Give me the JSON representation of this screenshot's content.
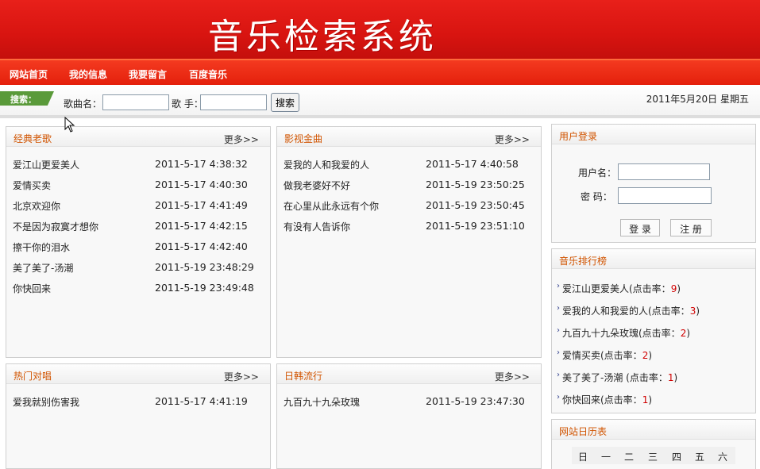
{
  "banner": {
    "title": "音乐检索系统"
  },
  "nav": {
    "items": [
      "网站首页",
      "我的信息",
      "我要留言",
      "百度音乐"
    ]
  },
  "search": {
    "tag": "搜索：",
    "song_label": "歌曲名：",
    "singer_label": "歌 手：",
    "button": "搜索",
    "song_value": "",
    "singer_value": ""
  },
  "date": "2011年5月20日 星期五",
  "panels": [
    {
      "title": "经典老歌",
      "more": "更多>>",
      "items": [
        {
          "song": "爱江山更爱美人",
          "time": "2011-5-17 4:38:32"
        },
        {
          "song": "爱情买卖",
          "time": "2011-5-17 4:40:30"
        },
        {
          "song": "北京欢迎你",
          "time": "2011-5-17 4:41:49"
        },
        {
          "song": "不是因为寂寞才想你",
          "time": "2011-5-17 4:42:15"
        },
        {
          "song": "擦干你的泪水",
          "time": "2011-5-17 4:42:40"
        },
        {
          "song": "美了美了-汤潮",
          "time": "2011-5-19 23:48:29"
        },
        {
          "song": "你快回来",
          "time": "2011-5-19 23:49:48"
        }
      ]
    },
    {
      "title": "影视金曲",
      "more": "更多>>",
      "items": [
        {
          "song": "爱我的人和我爱的人",
          "time": "2011-5-17 4:40:58"
        },
        {
          "song": "做我老婆好不好",
          "time": "2011-5-19 23:50:25"
        },
        {
          "song": "在心里从此永远有个你",
          "time": "2011-5-19 23:50:45"
        },
        {
          "song": "有没有人告诉你",
          "time": "2011-5-19 23:51:10"
        }
      ]
    },
    {
      "title": "热门对唱",
      "more": "更多>>",
      "items": [
        {
          "song": "爱我就别伤害我",
          "time": "2011-5-17 4:41:19"
        }
      ]
    },
    {
      "title": "日韩流行",
      "more": "更多>>",
      "items": [
        {
          "song": "九百九十九朵玫瑰",
          "time": "2011-5-19 23:47:30"
        }
      ]
    }
  ],
  "login": {
    "title": "用户登录",
    "username_label": "用户名：",
    "password_label": "密  码：",
    "username_value": "",
    "password_value": "",
    "login_button": "登 录",
    "register_button": "注 册"
  },
  "ranking": {
    "title": "音乐排行榜",
    "items": [
      {
        "song": "爱江山更爱美人(点击率：",
        "count": "9",
        "close": ")"
      },
      {
        "song": "爱我的人和我爱的人(点击率：",
        "count": "3",
        "close": ")"
      },
      {
        "song": "九百九十九朵玫瑰(点击率：",
        "count": "2",
        "close": ")"
      },
      {
        "song": "爱情买卖(点击率：",
        "count": "2",
        "close": ")"
      },
      {
        "song": "美了美了-汤潮 (点击率：",
        "count": "1",
        "close": ")"
      },
      {
        "song": "你快回来(点击率：",
        "count": "1",
        "close": ")"
      }
    ]
  },
  "calendar": {
    "title": "网站日历表",
    "weekdays": [
      "日",
      "一",
      "二",
      "三",
      "四",
      "五",
      "六"
    ]
  },
  "colors": {
    "banner": "#d81410",
    "nav": "#e4200c",
    "section_title": "#d15400",
    "search_tag": "#5a9a3a",
    "rank_count": "#d00000"
  }
}
